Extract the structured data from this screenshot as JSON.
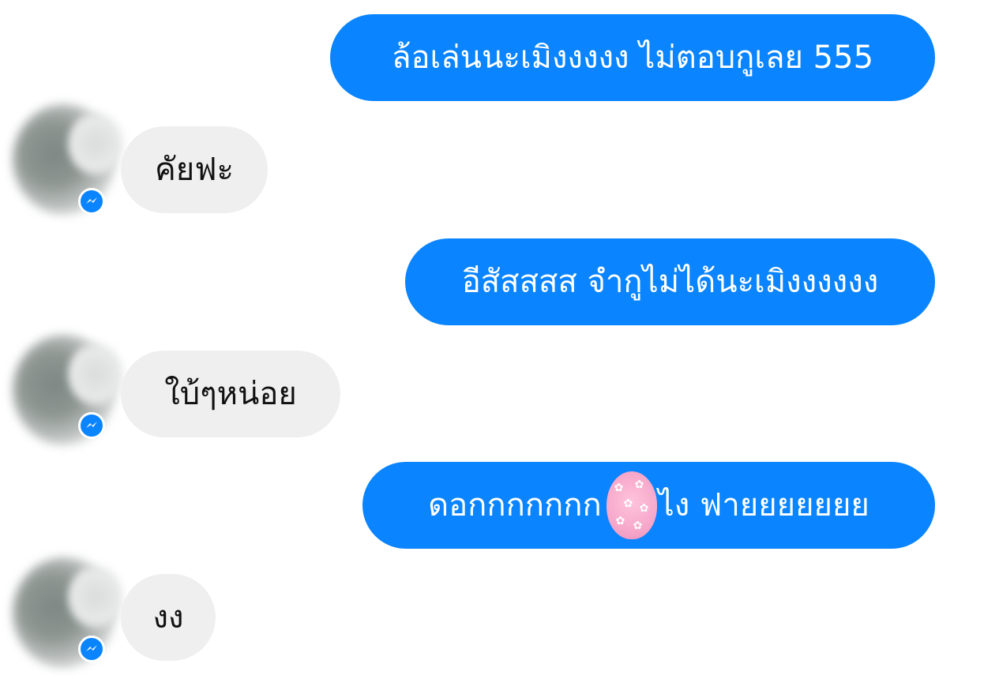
{
  "messages": [
    {
      "side": "sent",
      "text": "ล้อเล่นนะเมิงงงงง ไม่ตอบกูเลย 555"
    },
    {
      "side": "received",
      "text": "คัยฟะ"
    },
    {
      "side": "sent",
      "text": "อีสัสสสส จำกูไม่ได้นะเมิงงงงงง"
    },
    {
      "side": "received",
      "text": "ใบ้ๆหน่อย"
    },
    {
      "side": "sent",
      "text_before": "ดอกกกกกกก",
      "text_after": "ไง ฟายยยยยยย"
    },
    {
      "side": "received",
      "text": "งง"
    }
  ],
  "colors": {
    "sent_bubble": "#0a84ff",
    "received_bubble": "#efefef",
    "badge": "#0a84ff"
  },
  "icons": {
    "avatar": "blurred-avatar",
    "badge": "messenger-icon",
    "inline_emoji": "blurred-emoji"
  }
}
